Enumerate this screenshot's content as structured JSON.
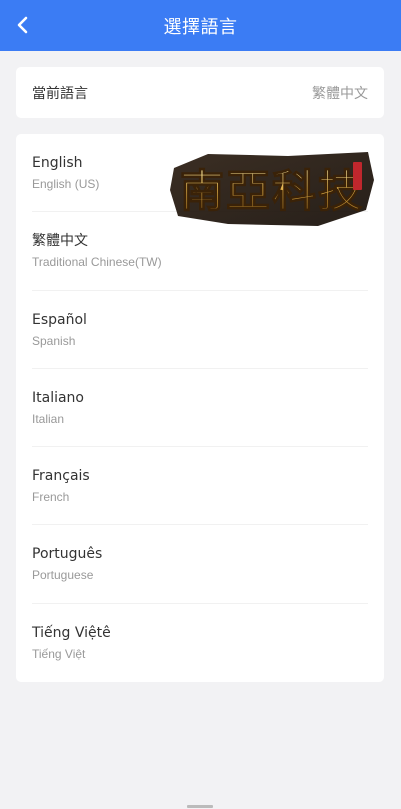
{
  "header": {
    "title": "選擇語言",
    "back_icon": "chevron-left-icon",
    "background_color": "#3b7cf4"
  },
  "current_language": {
    "label": "當前語言",
    "value": "繁體中文"
  },
  "languages": [
    {
      "name": "English",
      "subtitle": "English (US)"
    },
    {
      "name": "繁體中文",
      "subtitle": "Traditional Chinese(TW)"
    },
    {
      "name": "Español",
      "subtitle": "Spanish"
    },
    {
      "name": "Italiano",
      "subtitle": "Italian"
    },
    {
      "name": "Français",
      "subtitle": "French"
    },
    {
      "name": "Português",
      "subtitle": "Portuguese"
    },
    {
      "name": "Tiếng Việtê",
      "subtitle": "Tiếng Việt"
    }
  ],
  "watermark": {
    "text": "南亞科技"
  }
}
